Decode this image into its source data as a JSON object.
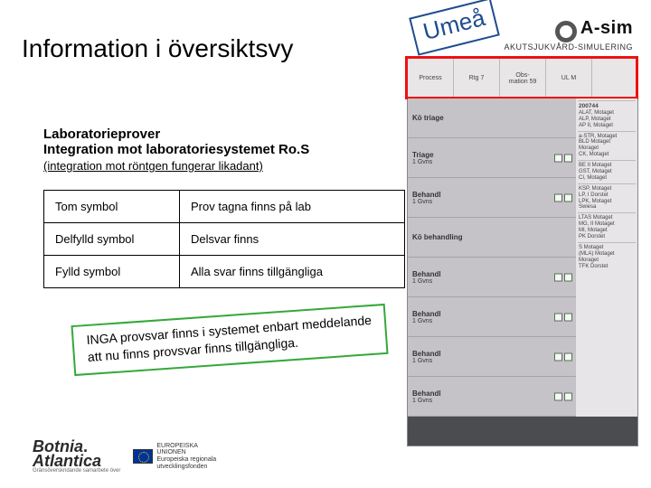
{
  "title": "Information i översiktsvy",
  "stamp": "Umeå",
  "asim": {
    "brand": "A-sim",
    "tagline": "AKUTSJUKVÅRD-SIMULERING"
  },
  "lab": {
    "heading": "Laboratorieprover",
    "subheading": "Integration mot laboratoriesystemet Ro.S",
    "note": "(integration mot röntgen fungerar likadant)",
    "rows": [
      {
        "label": "Tom symbol",
        "desc": "Prov tagna finns på lab"
      },
      {
        "label": "Delfylld symbol",
        "desc": "Delsvar finns"
      },
      {
        "label": "Fylld symbol",
        "desc": "Alla svar finns tillgängliga"
      }
    ]
  },
  "green_note": {
    "line1": "INGA provsvar finns i systemet enbart meddelande",
    "line2": "att nu finns provsvar finns tillgängliga."
  },
  "footer": {
    "botnia1": "Botnia",
    "botnia2": "Atlantica",
    "eu1": "EUROPEISKA",
    "eu2": "UNIONEN",
    "eu3": "Europeiska regionala",
    "eu4": "utvecklingsfonden",
    "eu_slogan": "Gränsöverskridande samarbete över"
  },
  "screenshot": {
    "tabs": [
      {
        "l1": "Process",
        "l2": ""
      },
      {
        "l1": "Rtg 7",
        "l2": ""
      },
      {
        "l1": "Obs-",
        "l2": "mation 59"
      },
      {
        "l1": "UL M",
        "l2": ""
      },
      {
        "l1": "",
        "l2": ""
      }
    ],
    "rows": [
      {
        "title": "Kö triage",
        "sub": ""
      },
      {
        "title": "Triage",
        "sub": "1 Gvns"
      },
      {
        "title": "Behandl",
        "sub": "1 Gvns"
      },
      {
        "title": "Kö behandling",
        "sub": ""
      },
      {
        "title": "Behandl",
        "sub": "1 Gvns"
      },
      {
        "title": "Behandl",
        "sub": "1 Gvns"
      },
      {
        "title": "Behandl",
        "sub": "1 Gvns"
      },
      {
        "title": "Behandl",
        "sub": "1 Gvns"
      }
    ],
    "panels": [
      {
        "h": "200744",
        "body": "ALAT, Motaget\nALP, Motaget\nAP II, Motaget"
      },
      {
        "h": "",
        "body": "a-STR, Motaget\nBLD Motaget\nMoraget\nCK, Motaget"
      },
      {
        "h": "",
        "body": "BE II Motaget\nGST, Motaget\nCI, Motaget"
      },
      {
        "h": "",
        "body": "KSP, Motaget\nLP, I Dorstet\nLPK, Motaget\nSwiesa"
      },
      {
        "h": "",
        "body": "LTAS Motaget\nMG, II Motaget\nMI, Motaget\nPK Dorstet"
      },
      {
        "h": "",
        "body": "S Motaget\n(MLA) Motaget\nMoraget\nTFK Dorstet"
      }
    ]
  }
}
